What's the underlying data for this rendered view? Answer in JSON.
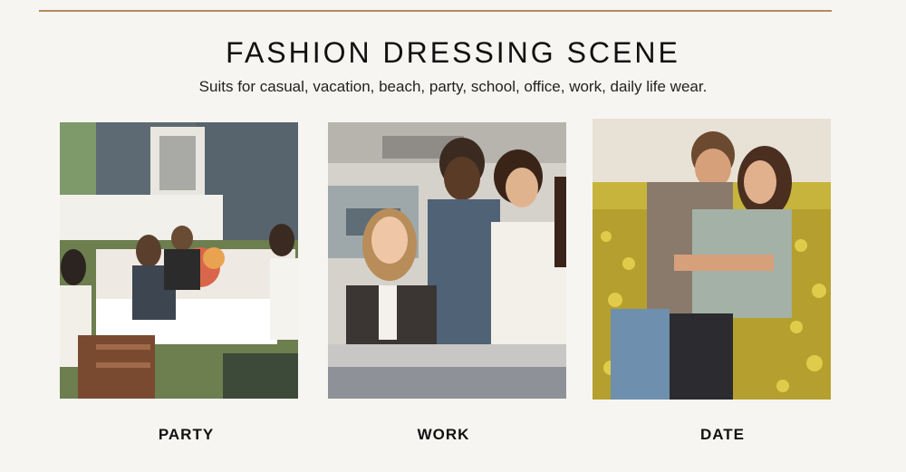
{
  "header": {
    "title": "FASHION DRESSING SCENE",
    "subtitle": "Suits for casual, vacation, beach, party, school, office, work, daily life wear."
  },
  "scenes": [
    {
      "label": "PARTY",
      "image": "outdoor-party-table-photo"
    },
    {
      "label": "WORK",
      "image": "office-team-laptop-photo"
    },
    {
      "label": "DATE",
      "image": "couple-hugging-flower-field-photo"
    }
  ],
  "colors": {
    "background": "#f6f5f1",
    "rule": "#b48a63"
  }
}
